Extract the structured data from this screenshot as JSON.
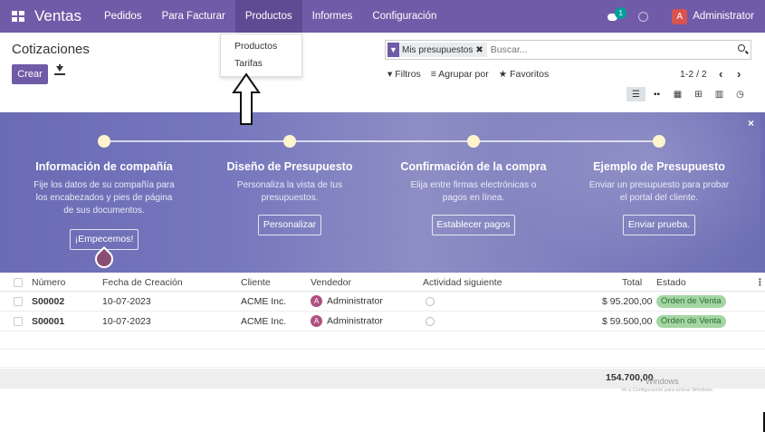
{
  "navbar": {
    "app_name": "Ventas",
    "menu": [
      "Pedidos",
      "Para Facturar",
      "Productos",
      "Informes",
      "Configuración"
    ],
    "active_menu": "Productos",
    "chat_badge": "1",
    "avatar_letter": "A",
    "user": "Administrator",
    "color": "#6f5ba7"
  },
  "dropdown": {
    "items": [
      "Productos",
      "Tarifas"
    ]
  },
  "page": {
    "title": "Cotizaciones",
    "create_label": "Crear"
  },
  "search": {
    "facet": "Mis presupuestos",
    "facet_close": "✖",
    "placeholder": "Buscar..."
  },
  "filters": {
    "filter_label": "Filtros",
    "group_label": "Agrupar por",
    "favorites_label": "Favoritos"
  },
  "pager": {
    "value": "1-2 / 2"
  },
  "views": [
    "list-icon",
    "kanban-icon",
    "calendar-icon",
    "pivot-icon",
    "graph-icon",
    "activity-icon"
  ],
  "banner": {
    "close": "×",
    "steps": [
      {
        "title": "Información de compañía",
        "desc": "Fije los datos de su compañía para los encabezados y pies de página de sus documentos.",
        "button": "¡Empecemos!"
      },
      {
        "title": "Diseño de Presupuesto",
        "desc": "Personaliza la vista de tus presupuestos.",
        "button": "Personalizar"
      },
      {
        "title": "Confirmación de la compra",
        "desc": "Elija entre firmas electrónicas o pagos en línea.",
        "button": "Establecer pagos"
      },
      {
        "title": "Ejemplo de Presupuesto",
        "desc": "Enviar un presupuesto para probar el portal del cliente.",
        "button": "Enviar prueba."
      }
    ]
  },
  "table": {
    "columns": [
      "Número",
      "Fecha de Creación",
      "Cliente",
      "Vendedor",
      "Actividad siguiente",
      "Total",
      "Estado"
    ],
    "rows": [
      {
        "number": "S00002",
        "date": "10-07-2023",
        "client": "ACME Inc.",
        "seller_initial": "A",
        "seller": "Administrator",
        "total": "$ 95.200,00",
        "state": "Orden de Venta"
      },
      {
        "number": "S00001",
        "date": "10-07-2023",
        "client": "ACME Inc.",
        "seller_initial": "A",
        "seller": "Administrator",
        "total": "$ 59.500,00",
        "state": "Orden de Venta"
      }
    ],
    "footer_total": "154.700,00",
    "state_color": "#a4d6a4"
  },
  "watermark": {
    "line1": "Windows",
    "line2": "Ve a Configuración para activar Windows."
  }
}
